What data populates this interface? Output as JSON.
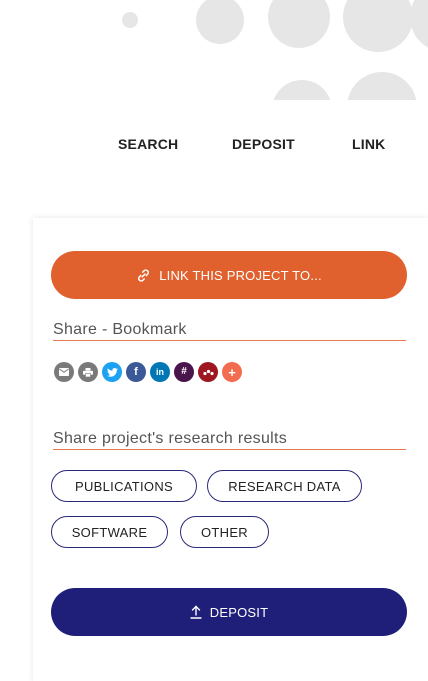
{
  "nav": {
    "search": "SEARCH",
    "deposit": "DEPOSIT",
    "link": "LINK"
  },
  "card": {
    "link_button": "LINK THIS PROJECT TO...",
    "share_title": "Share - Bookmark",
    "social_icons": [
      {
        "name": "email-icon",
        "color": "#7a7a7a"
      },
      {
        "name": "print-icon",
        "color": "#7a7a7a"
      },
      {
        "name": "twitter-icon",
        "color": "#1da1f2"
      },
      {
        "name": "facebook-icon",
        "color": "#3b5998"
      },
      {
        "name": "linkedin-icon",
        "color": "#0077b5"
      },
      {
        "name": "slack-icon",
        "color": "#4a154b"
      },
      {
        "name": "mendeley-icon",
        "color": "#9d1620"
      },
      {
        "name": "more-icon",
        "color": "#f26c4f"
      }
    ],
    "results_title": "Share project's research results",
    "pills": {
      "publications": "PUBLICATIONS",
      "research_data": "RESEARCH DATA",
      "software": "SOFTWARE",
      "other": "OTHER"
    },
    "deposit_button": "DEPOSIT"
  },
  "colors": {
    "accent_orange": "#e0612e",
    "accent_navy": "#1f1f7a"
  }
}
